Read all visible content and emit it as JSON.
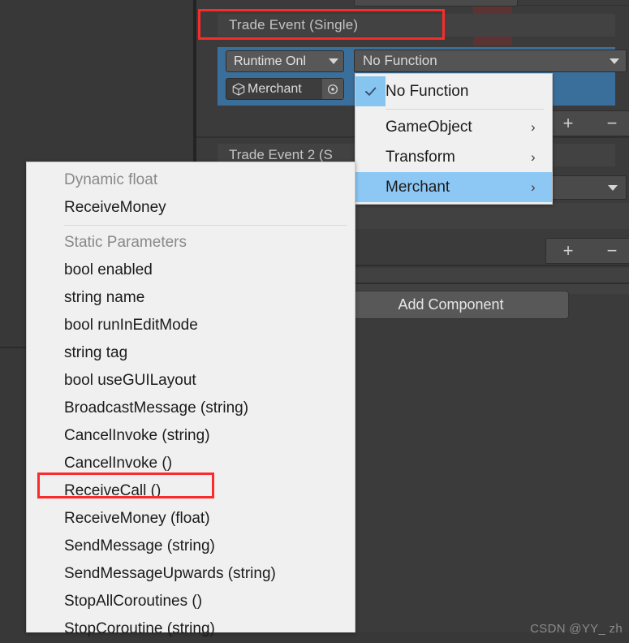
{
  "editor": {
    "event_header": "Trade Event (Single)",
    "event2_header": "Trade Event 2 (S",
    "runtime_mode": "Runtime Onl",
    "object_name": "Merchant",
    "function_field": "No Function",
    "add_component": "Add Component",
    "plus_symbol": "+",
    "minus_symbol": "−",
    "watermark": "CSDN @YY_ zh",
    "icons": {
      "search": "search-icon",
      "cube": "cube-icon",
      "target": "target-select-icon",
      "caret": "chevron-down-icon"
    },
    "colors": {
      "background": "#383838",
      "inspector": "#3b3b3b",
      "selection_blue": "#3a6f9c",
      "annotation_red": "#fa2b2b",
      "menu_background": "#f0f0f0",
      "menu_highlight": "#8dc8f5",
      "check_cell": "#86c5f0"
    }
  },
  "function_menu": {
    "items": [
      {
        "label": "No Function",
        "checked": true,
        "submenu": false,
        "highlight": false
      },
      {
        "label": "GameObject",
        "checked": false,
        "submenu": true,
        "highlight": false
      },
      {
        "label": "Transform",
        "checked": false,
        "submenu": true,
        "highlight": false
      },
      {
        "label": "Merchant",
        "checked": false,
        "submenu": true,
        "highlight": true
      }
    ],
    "submenu_arrow": "›",
    "check_glyph": "✓"
  },
  "member_menu": {
    "sections": [
      {
        "header": "Dynamic float",
        "items": [
          "ReceiveMoney"
        ]
      },
      {
        "header": "Static Parameters",
        "items": [
          "bool enabled",
          "string name",
          "bool runInEditMode",
          "string tag",
          "bool useGUILayout",
          "BroadcastMessage (string)",
          "CancelInvoke (string)",
          "CancelInvoke ()",
          "ReceiveCall ()",
          "ReceiveMoney (float)",
          "SendMessage (string)",
          "SendMessageUpwards (string)",
          "StopAllCoroutines ()",
          "StopCoroutine (string)"
        ]
      }
    ],
    "highlighted_item": "ReceiveCall ()"
  }
}
